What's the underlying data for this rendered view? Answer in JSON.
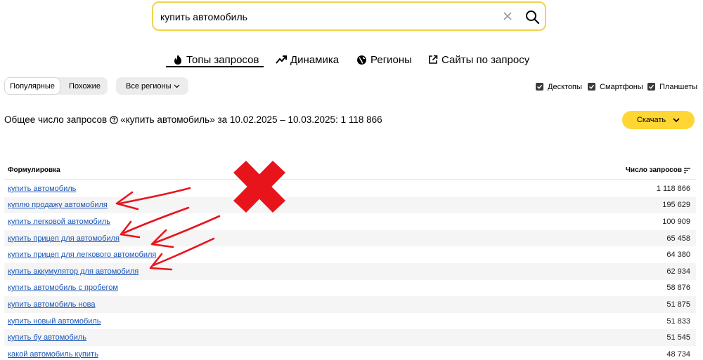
{
  "search": {
    "value": "купить автомобиль"
  },
  "tabs": [
    {
      "label": "Топы запросов",
      "icon": "fire-icon",
      "active": true
    },
    {
      "label": "Динамика",
      "icon": "trend-icon",
      "active": false
    },
    {
      "label": "Регионы",
      "icon": "globe-icon",
      "active": false
    },
    {
      "label": "Сайты по запросу",
      "icon": "external-link-icon",
      "active": false
    }
  ],
  "filters": {
    "popular": "Популярные",
    "similar": "Похожие",
    "regions": "Все регионы",
    "devices": [
      {
        "label": "Десктопы",
        "checked": true
      },
      {
        "label": "Смартфоны",
        "checked": true
      },
      {
        "label": "Планшеты",
        "checked": true
      }
    ]
  },
  "summary": {
    "prefix": "Общее число запросов",
    "suffix": "«купить автомобиль» за 10.02.2025 – 10.03.2025: 1 118 866"
  },
  "download_label": "Скачать",
  "table": {
    "col_phrase": "Формулировка",
    "col_count": "Число запросов",
    "rows": [
      {
        "phrase": "купить автомобиль",
        "count": "1 118 866"
      },
      {
        "phrase": "куплю продажу автомобиля",
        "count": "195 629"
      },
      {
        "phrase": "купить легковой автомобиль",
        "count": "100 909"
      },
      {
        "phrase": "купить прицеп для автомобиля",
        "count": "65 458"
      },
      {
        "phrase": "купить прицеп для легкового автомобиля",
        "count": "64 380"
      },
      {
        "phrase": "купить аккумулятор для автомобиля",
        "count": "62 934"
      },
      {
        "phrase": "купить автомобиль с пробегом",
        "count": "58 876"
      },
      {
        "phrase": "купить автомобиль нова",
        "count": "51 875"
      },
      {
        "phrase": "купить новый автомобиль",
        "count": "51 833"
      },
      {
        "phrase": "купить бу автомобиль",
        "count": "51 545"
      },
      {
        "phrase": "какой автомобиль купить",
        "count": "48 734"
      }
    ]
  },
  "colors": {
    "accent": "#ffd633",
    "search_border": "#f0d44a",
    "link": "#1a55b5",
    "annotation": "#e8141c"
  }
}
